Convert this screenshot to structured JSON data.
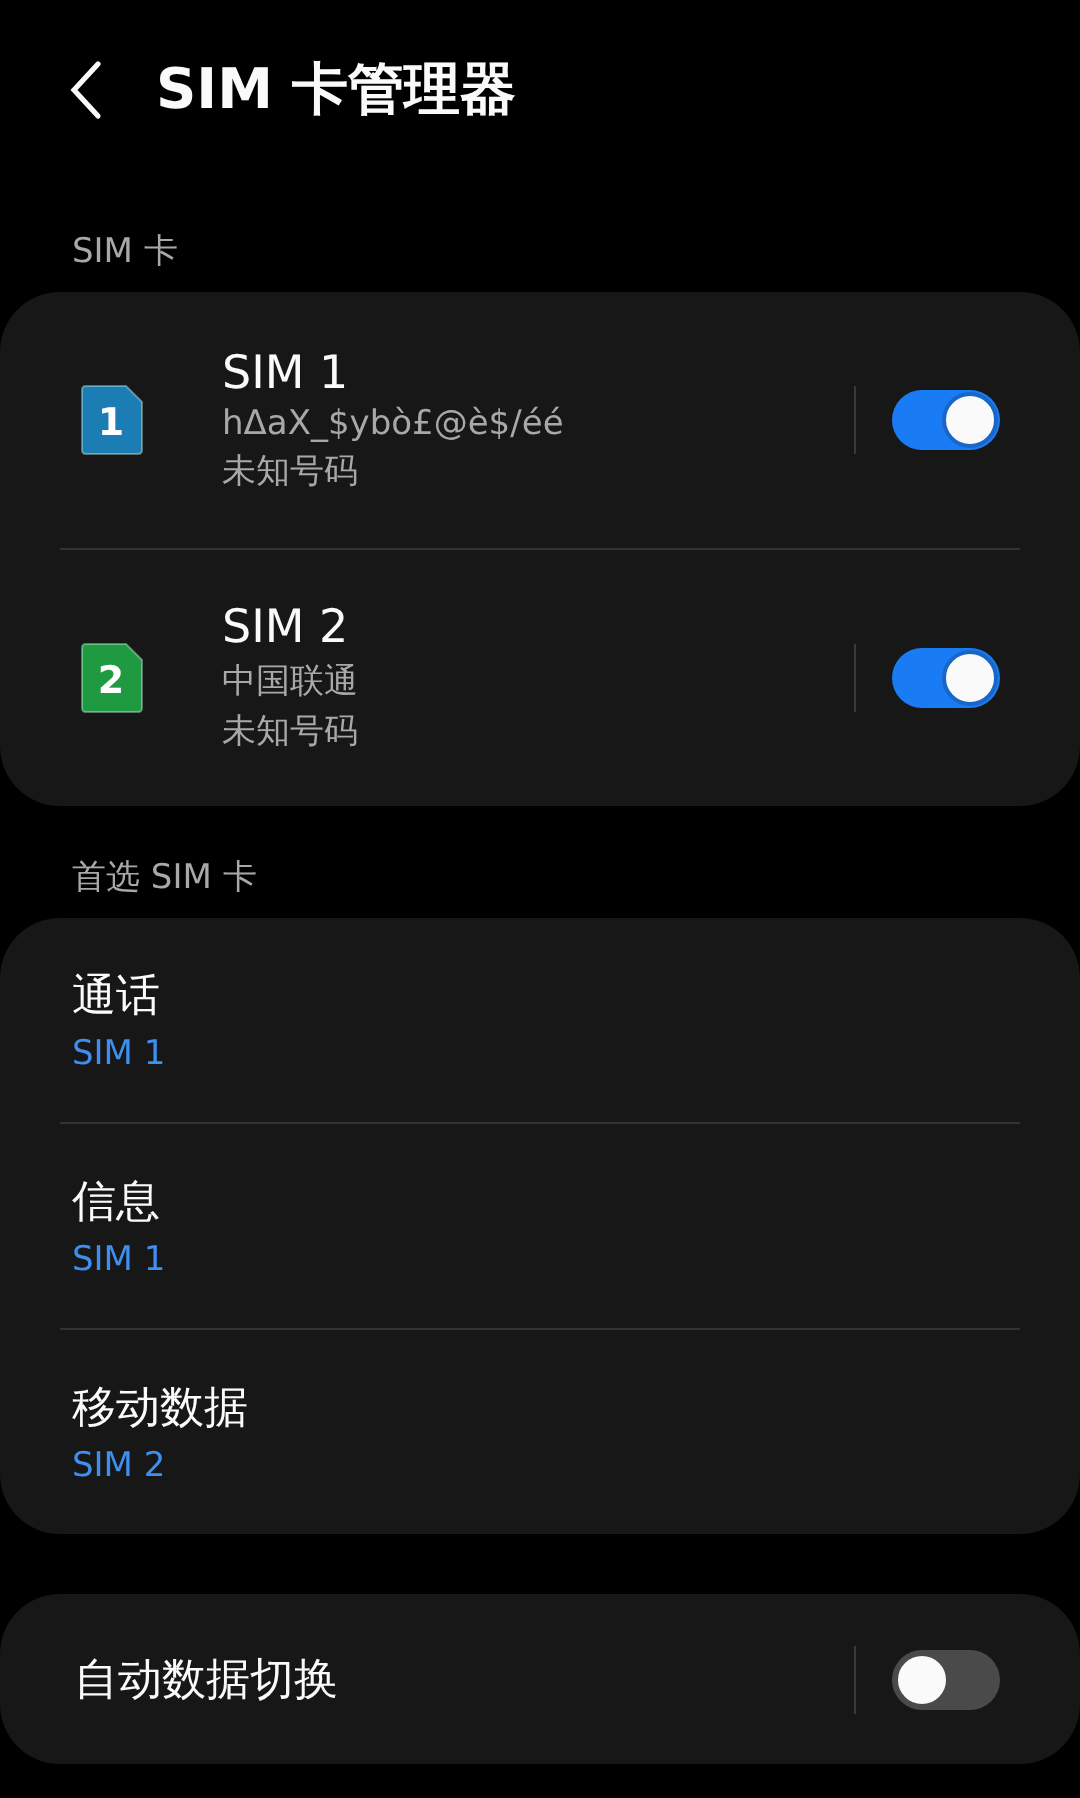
{
  "header": {
    "title": "SIM 卡管理器"
  },
  "sim_section": {
    "title": "SIM 卡",
    "cards": [
      {
        "number": "1",
        "name": "SIM 1",
        "carrier": "hΔaX_$ybò£@è$/éé",
        "phone": "未知号码",
        "color": "#1b7db3",
        "on": true
      },
      {
        "number": "2",
        "name": "SIM 2",
        "carrier": "中国联通",
        "phone": "未知号码",
        "color": "#1f9a40",
        "on": true
      }
    ]
  },
  "preferred_section": {
    "title": "首选 SIM 卡",
    "items": [
      {
        "label": "通话",
        "value": "SIM 1"
      },
      {
        "label": "信息",
        "value": "SIM 1"
      },
      {
        "label": "移动数据",
        "value": "SIM 2"
      }
    ]
  },
  "auto_switch": {
    "label": "自动数据切换",
    "on": false
  }
}
